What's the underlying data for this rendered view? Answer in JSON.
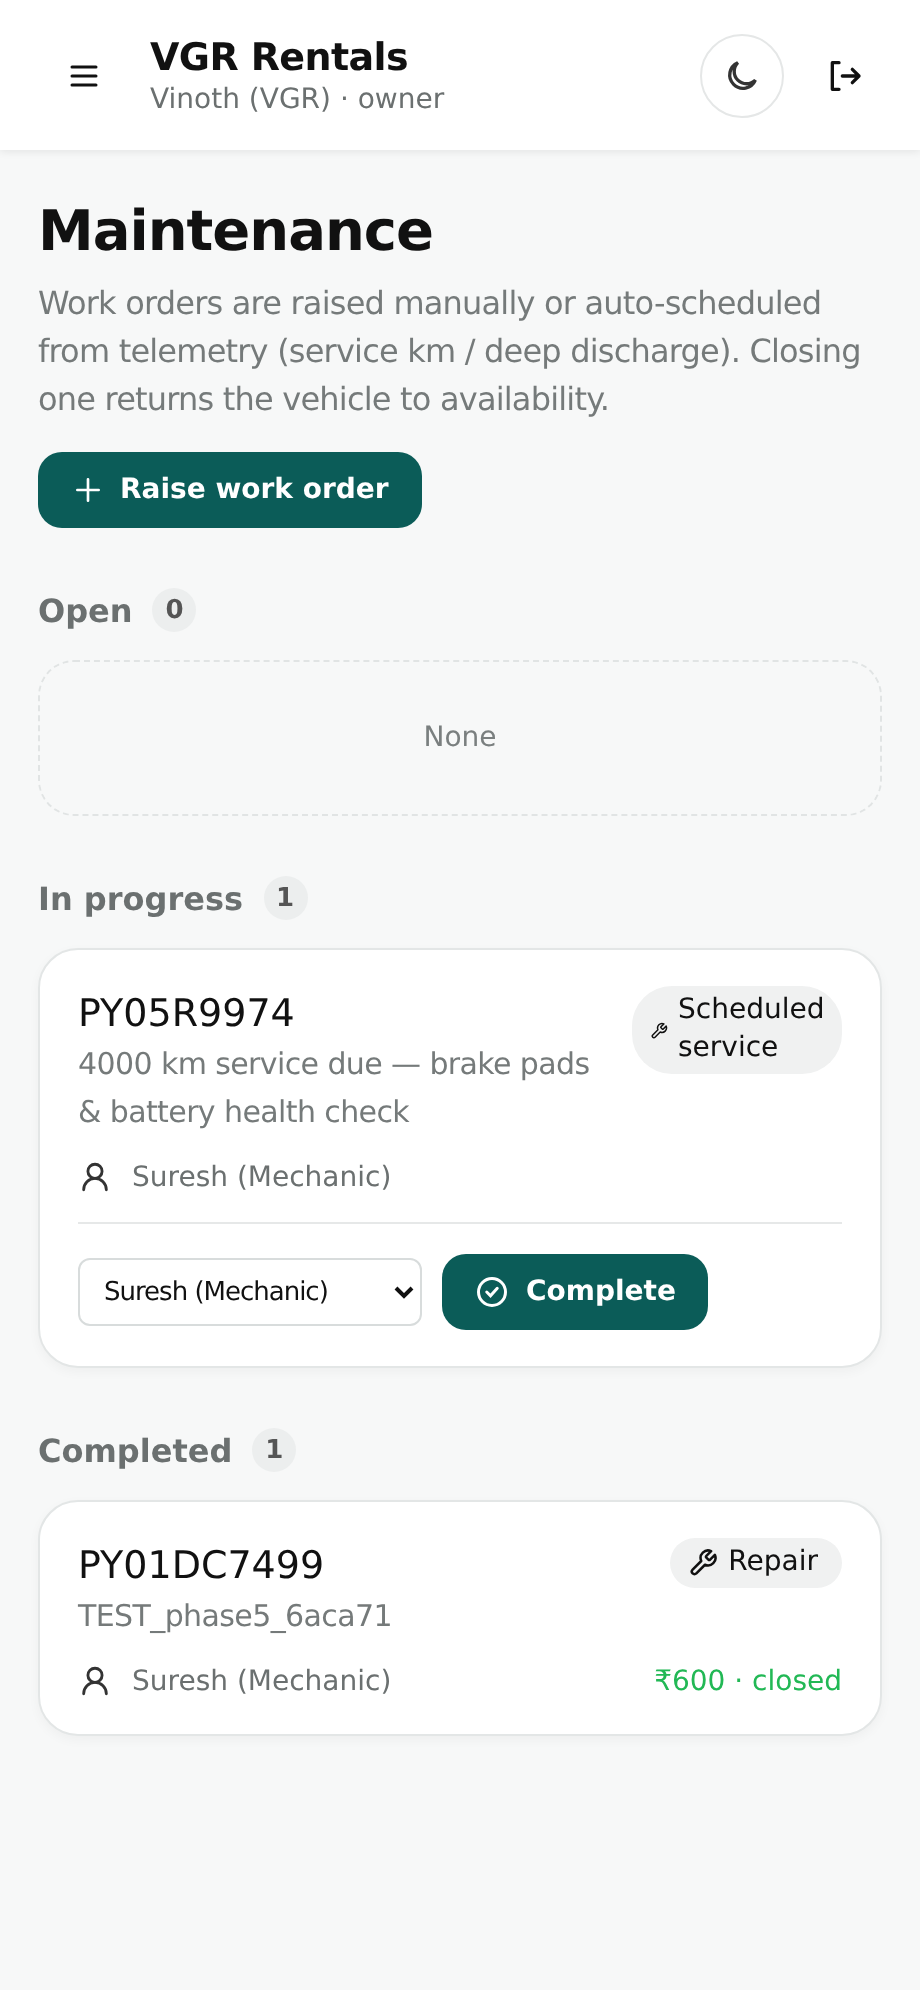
{
  "header": {
    "title": "VGR Rentals",
    "subtitle": "Vinoth (VGR) · owner"
  },
  "page": {
    "title": "Maintenance",
    "description": "Work orders are raised manually or auto-scheduled from telemetry (service km / deep discharge). Closing one returns the vehicle to availability.",
    "action": "Raise work order"
  },
  "sections": [
    {
      "title": "Open",
      "count": "0",
      "empty": "None"
    },
    {
      "title": "In progress",
      "count": "1",
      "cards": [
        {
          "kind": "active",
          "plate": "PY05R9974",
          "description": "4000 km service due — brake pads & battery health check",
          "tag": "Scheduled service",
          "assignee": "Suresh (Mechanic)",
          "select_value": "Suresh (Mechanic)",
          "button": "Complete"
        }
      ]
    },
    {
      "title": "Completed",
      "count": "1",
      "cards": [
        {
          "kind": "completed",
          "plate": "PY01DC7499",
          "description": "TEST_phase5_6aca71",
          "tag": "Repair",
          "assignee": "Suresh (Mechanic)",
          "cost": "₹600 · closed"
        }
      ]
    }
  ]
}
